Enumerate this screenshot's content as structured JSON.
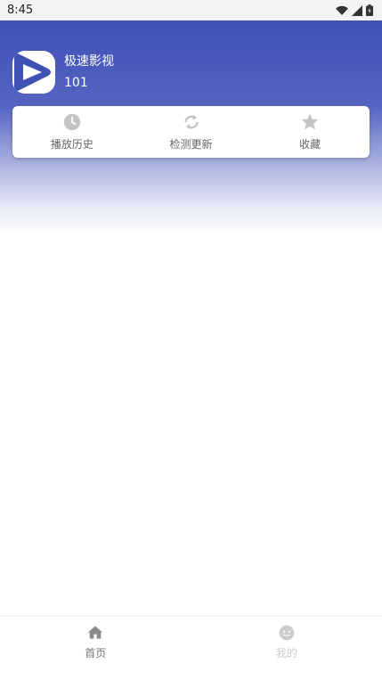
{
  "status_bar": {
    "time": "8:45",
    "icons": [
      "wifi-icon",
      "signal-icon",
      "battery-icon"
    ]
  },
  "app": {
    "name": "极速影视",
    "version": "101",
    "icon": "play-logo-icon"
  },
  "quick_actions": [
    {
      "label": "播放历史",
      "icon": "clock-icon"
    },
    {
      "label": "检测更新",
      "icon": "refresh-icon"
    },
    {
      "label": "收藏",
      "icon": "star-icon"
    }
  ],
  "bottom_nav": [
    {
      "label": "首页",
      "icon": "home-icon",
      "active": true
    },
    {
      "label": "我的",
      "icon": "smiley-icon",
      "active": false
    }
  ],
  "colors": {
    "primary": "#3f51b5",
    "icon_gray": "#c4c4c4",
    "label_gray": "#666666"
  }
}
